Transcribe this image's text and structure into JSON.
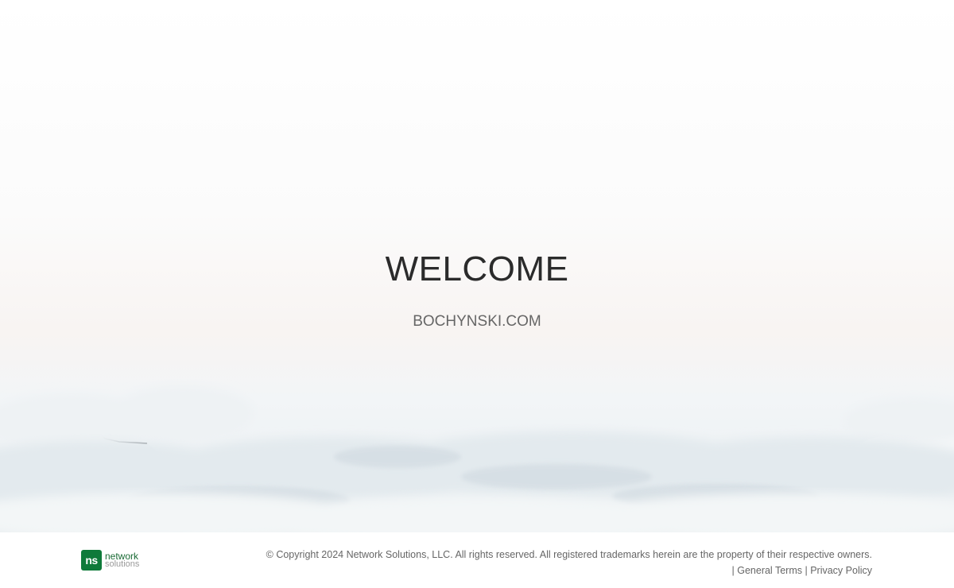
{
  "hero": {
    "title": "WELCOME",
    "domain": "BOCHYNSKI.COM"
  },
  "footer": {
    "logo": {
      "mark": "ns",
      "line1": "network",
      "line2": "solutions",
      "color": "#0f7a3a"
    },
    "copyright": "© Copyright 2024 Network Solutions, LLC. All rights reserved. All registered trademarks herein are the property of their respective owners.",
    "separator": "|",
    "links": {
      "terms": "General Terms",
      "privacy": "Privacy Policy"
    }
  },
  "colors": {
    "title": "#2b2b2b",
    "domain": "#666666",
    "footer_text": "#666666"
  }
}
